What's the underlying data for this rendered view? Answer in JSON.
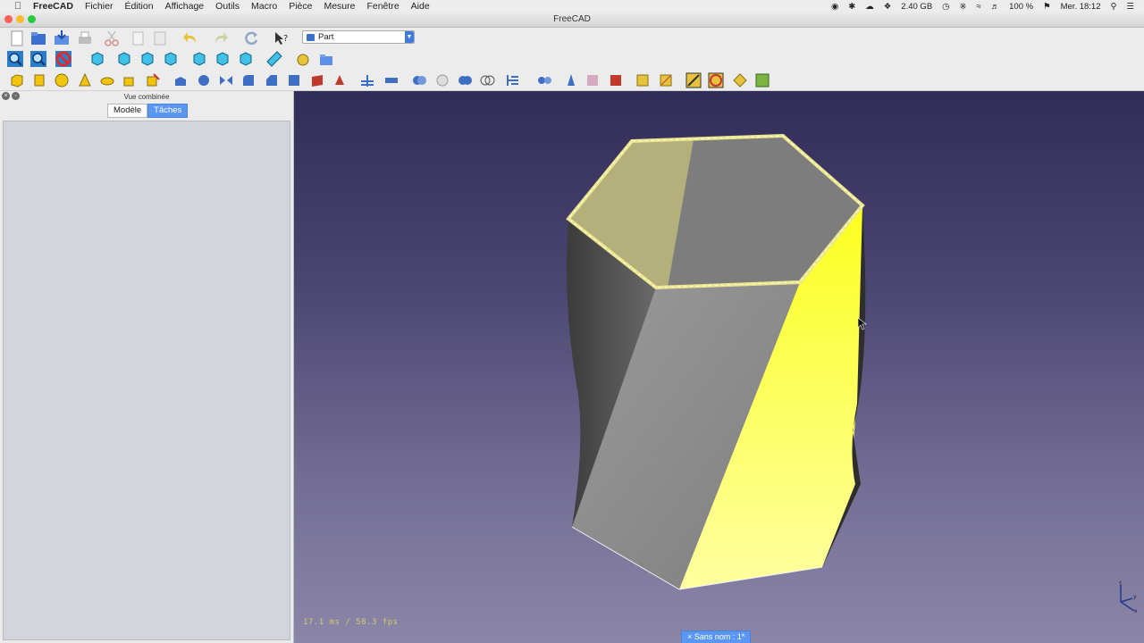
{
  "menubar": {
    "app": "FreeCAD",
    "items": [
      "Fichier",
      "Édition",
      "Affichage",
      "Outils",
      "Macro",
      "Pièce",
      "Mesure",
      "Fenêtre",
      "Aide"
    ],
    "storage": "2.40 GB",
    "battery": "100 %",
    "clock": "Mer. 18:12"
  },
  "window": {
    "title": "FreeCAD"
  },
  "workbench": {
    "selected": "Part"
  },
  "combo": {
    "title": "Vue combinée",
    "tabs": [
      "Modèle",
      "Tâches"
    ],
    "active_tab": "Tâches"
  },
  "view": {
    "fps": "17.1 ms / 58.3 fps",
    "document_tab": "Sans nom : 1*"
  },
  "colors": {
    "selection": "#ffff4a",
    "background_top": "#322c59",
    "background_bottom": "#8b86a8"
  }
}
